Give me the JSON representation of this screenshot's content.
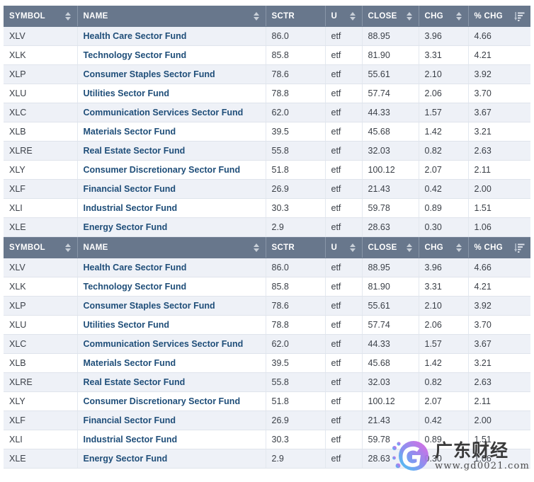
{
  "table": {
    "columns": [
      {
        "key": "symbol",
        "label": "SYMBOL",
        "sort": "updown"
      },
      {
        "key": "name",
        "label": "NAME",
        "sort": "updown"
      },
      {
        "key": "sctr",
        "label": "SCTR",
        "sort": "none"
      },
      {
        "key": "u",
        "label": "U",
        "sort": "updown"
      },
      {
        "key": "close",
        "label": "CLOSE",
        "sort": "updown"
      },
      {
        "key": "chg",
        "label": "CHG",
        "sort": "updown"
      },
      {
        "key": "pchg",
        "label": "% CHG",
        "sort": "desc-active"
      }
    ],
    "rows": [
      {
        "symbol": "XLV",
        "name": "Health Care Sector Fund",
        "sctr": "86.0",
        "u": "etf",
        "close": "88.95",
        "chg": "3.96",
        "pchg": "4.66"
      },
      {
        "symbol": "XLK",
        "name": "Technology Sector Fund",
        "sctr": "85.8",
        "u": "etf",
        "close": "81.90",
        "chg": "3.31",
        "pchg": "4.21"
      },
      {
        "symbol": "XLP",
        "name": "Consumer Staples Sector Fund",
        "sctr": "78.6",
        "u": "etf",
        "close": "55.61",
        "chg": "2.10",
        "pchg": "3.92"
      },
      {
        "symbol": "XLU",
        "name": "Utilities Sector Fund",
        "sctr": "78.8",
        "u": "etf",
        "close": "57.74",
        "chg": "2.06",
        "pchg": "3.70"
      },
      {
        "symbol": "XLC",
        "name": "Communication Services Sector Fund",
        "sctr": "62.0",
        "u": "etf",
        "close": "44.33",
        "chg": "1.57",
        "pchg": "3.67"
      },
      {
        "symbol": "XLB",
        "name": "Materials Sector Fund",
        "sctr": "39.5",
        "u": "etf",
        "close": "45.68",
        "chg": "1.42",
        "pchg": "3.21"
      },
      {
        "symbol": "XLRE",
        "name": "Real Estate Sector Fund",
        "sctr": "55.8",
        "u": "etf",
        "close": "32.03",
        "chg": "0.82",
        "pchg": "2.63"
      },
      {
        "symbol": "XLY",
        "name": "Consumer Discretionary Sector Fund",
        "sctr": "51.8",
        "u": "etf",
        "close": "100.12",
        "chg": "2.07",
        "pchg": "2.11"
      },
      {
        "symbol": "XLF",
        "name": "Financial Sector Fund",
        "sctr": "26.9",
        "u": "etf",
        "close": "21.43",
        "chg": "0.42",
        "pchg": "2.00"
      },
      {
        "symbol": "XLI",
        "name": "Industrial Sector Fund",
        "sctr": "30.3",
        "u": "etf",
        "close": "59.78",
        "chg": "0.89",
        "pchg": "1.51"
      },
      {
        "symbol": "XLE",
        "name": "Energy Sector Fund",
        "sctr": "2.9",
        "u": "etf",
        "close": "28.63",
        "chg": "0.30",
        "pchg": "1.06"
      }
    ]
  },
  "watermark": {
    "logo_letter": "G",
    "site_name": "广东财经",
    "site_url": "www.gd0021.com"
  },
  "colors": {
    "header_bg": "#68778c",
    "header_text": "#ffffff",
    "row_alt_bg": "#eef1f7",
    "row_bg": "#ffffff",
    "link": "#1f4e79",
    "cell_text": "#3a3f47",
    "border": "#dfe4ec"
  }
}
